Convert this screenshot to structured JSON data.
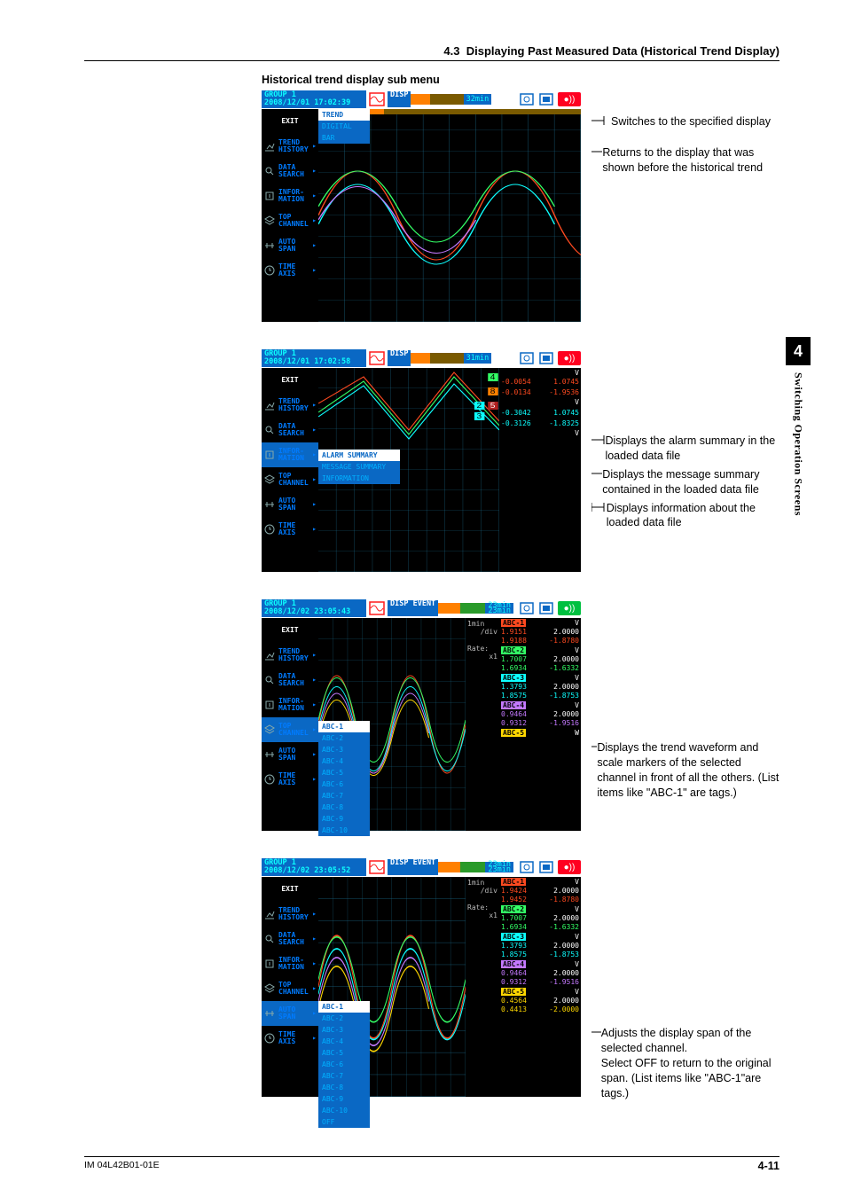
{
  "sectionNumber": "4.3",
  "sectionTitle": "Displaying Past Measured Data (Historical Trend Display)",
  "sideTabIndex": "4",
  "sideTabText": "Switching Operation Screens",
  "figureCaption": "Historical trend display sub menu",
  "footer": {
    "docNum": "IM 04L42B01-01E",
    "pageNum": "4-11"
  },
  "fig1": {
    "group": "GROUP 1",
    "timestamp": "2008/12/01 17:02:39",
    "dispLabel": "DISP",
    "timeSpan": "32min",
    "menu": [
      {
        "key": "exit",
        "label": "EXIT",
        "icon": "",
        "class": "exit"
      },
      {
        "key": "trend-history",
        "label": "TREND HISTORY",
        "icon": "chart"
      },
      {
        "key": "data-search",
        "label": "DATA SEARCH",
        "icon": "search"
      },
      {
        "key": "infor-mation",
        "label": "INFOR- MATION",
        "icon": "info"
      },
      {
        "key": "top-channel",
        "label": "TOP CHANNEL",
        "icon": "layers"
      },
      {
        "key": "auto-span",
        "label": "AUTO SPAN",
        "icon": "span"
      },
      {
        "key": "time-axis",
        "label": "TIME AXIS",
        "icon": "clock"
      }
    ],
    "submenu1": [
      "TREND",
      "DIGITAL",
      "BAR"
    ],
    "anno1": "Switches to the specified display",
    "anno2": "Returns to the display that was shown before the historical trend"
  },
  "fig2": {
    "group": "GROUP 1",
    "timestamp": "2008/12/01 17:02:58",
    "dispLabel": "DISP",
    "timeSpan": "31min",
    "menu": [
      {
        "key": "exit",
        "label": "EXIT",
        "icon": "",
        "class": "exit"
      },
      {
        "key": "trend-history",
        "label": "TREND HISTORY",
        "icon": "chart"
      },
      {
        "key": "data-search",
        "label": "DATA SEARCH",
        "icon": "search"
      },
      {
        "key": "infor-mation",
        "label": "INFOR- MATION",
        "icon": "info",
        "hot": true
      },
      {
        "key": "top-channel",
        "label": "TOP CHANNEL",
        "icon": "layers"
      },
      {
        "key": "auto-span",
        "label": "AUTO SPAN",
        "icon": "span"
      },
      {
        "key": "time-axis",
        "label": "TIME AXIS",
        "icon": "clock"
      }
    ],
    "submenu1": [
      "ALARM SUMMARY",
      "MESSAGE SUMMARY",
      "INFORMATION"
    ],
    "rightValues": [
      {
        "name": "",
        "unit": "V",
        "v1": "-0.0054",
        "v2": "1.0745",
        "c": "#ff4a20"
      },
      {
        "name": "",
        "unit": "",
        "v1": "-0.0134",
        "v2": "-1.9536",
        "c": "#ff4a20"
      },
      {
        "name": "",
        "unit": "V",
        "v1": "",
        "v2": "",
        "c": "#33ff66"
      },
      {
        "name": "",
        "unit": "",
        "v1": "-0.3042",
        "v2": "1.0745",
        "c": "#0dffff"
      },
      {
        "name": "",
        "unit": "",
        "v1": "-0.3126",
        "v2": "-1.8325",
        "c": "#0dffff"
      },
      {
        "name": "",
        "unit": "V",
        "v1": "",
        "v2": "",
        "c": "#0dffff"
      }
    ],
    "markers": [
      "4",
      "8",
      "2",
      "5",
      "3"
    ],
    "anno1": "Displays the alarm summary in the loaded data file",
    "anno2": "Displays the message summary contained in the loaded data file",
    "anno3": "Displays information about the loaded data file"
  },
  "fig3": {
    "group": "GROUP 1",
    "timestamp": "2008/12/02 23:05:43",
    "dispLabel": "DISP EVENT",
    "timeSpan1": "23min",
    "timeSpan2": "23min",
    "leftInfo": {
      "line1": "1min",
      "line2": "/div",
      "line3": "Rate:",
      "line4": "x1"
    },
    "menu": [
      {
        "key": "exit",
        "label": "EXIT",
        "icon": "",
        "class": "exit"
      },
      {
        "key": "trend-history",
        "label": "TREND HISTORY",
        "icon": "chart"
      },
      {
        "key": "data-search",
        "label": "DATA SEARCH",
        "icon": "search"
      },
      {
        "key": "infor-mation",
        "label": "INFOR- MATION",
        "icon": "info"
      },
      {
        "key": "top-channel",
        "label": "TOP CHANNEL",
        "icon": "layers",
        "hot": true
      },
      {
        "key": "auto-span",
        "label": "AUTO SPAN",
        "icon": "span"
      },
      {
        "key": "time-axis",
        "label": "TIME AXIS",
        "icon": "clock"
      }
    ],
    "submenu1": [
      "ABC-1",
      "ABC-2",
      "ABC-3",
      "ABC-4",
      "ABC-5",
      "ABC-6",
      "ABC-7",
      "ABC-8",
      "ABC-9",
      "ABC-10"
    ],
    "channels": [
      {
        "name": "ABC-1",
        "unit": "V",
        "v1": "1.9151",
        "v2": "2.0000",
        "v3": "1.9188",
        "v4": "-1.8780",
        "color": "#ff4a20"
      },
      {
        "name": "ABC-2",
        "unit": "V",
        "v1": "1.7007",
        "v2": "2.0000",
        "v3": "1.6934",
        "v4": "-1.6332",
        "color": "#33ff66"
      },
      {
        "name": "ABC-3",
        "unit": "V",
        "v1": "1.3793",
        "v2": "2.0000",
        "v3": "1.8575",
        "v4": "-1.8753",
        "color": "#0dffff"
      },
      {
        "name": "ABC-4",
        "unit": "V",
        "v1": "0.9464",
        "v2": "2.0000",
        "v3": "0.9312",
        "v4": "-1.9516",
        "color": "#c479ff"
      },
      {
        "name": "ABC-5",
        "unit": "W",
        "v1": "",
        "v2": "",
        "v3": "",
        "v4": "",
        "color": "#ffd800"
      }
    ],
    "anno1": "Displays the trend waveform and scale markers of the selected channel in front of all the others. (List items like \"ABC-1\" are tags.)"
  },
  "fig4": {
    "group": "GROUP 1",
    "timestamp": "2008/12/02 23:05:52",
    "dispLabel": "DISP EVENT",
    "timeSpan1": "23min",
    "timeSpan2": "23min",
    "leftInfo": {
      "line1": "1min",
      "line2": "/div",
      "line3": "Rate:",
      "line4": "x1"
    },
    "menu": [
      {
        "key": "exit",
        "label": "EXIT",
        "icon": "",
        "class": "exit"
      },
      {
        "key": "trend-history",
        "label": "TREND HISTORY",
        "icon": "chart"
      },
      {
        "key": "data-search",
        "label": "DATA SEARCH",
        "icon": "search"
      },
      {
        "key": "infor-mation",
        "label": "INFOR- MATION",
        "icon": "info"
      },
      {
        "key": "top-channel",
        "label": "TOP CHANNEL",
        "icon": "layers"
      },
      {
        "key": "auto-span",
        "label": "AUTO SPAN",
        "icon": "span",
        "hot": true
      },
      {
        "key": "time-axis",
        "label": "TIME AXIS",
        "icon": "clock"
      }
    ],
    "submenu1": [
      "ABC-1",
      "ABC-2",
      "ABC-3",
      "ABC-4",
      "ABC-5",
      "ABC-6",
      "ABC-7",
      "ABC-8",
      "ABC-9",
      "ABC-10",
      "OFF"
    ],
    "channels": [
      {
        "name": "ABC-1",
        "unit": "V",
        "v1": "1.9424",
        "v2": "2.0000",
        "v3": "1.9452",
        "v4": "-1.8780",
        "color": "#ff4a20"
      },
      {
        "name": "ABC-2",
        "unit": "V",
        "v1": "1.7007",
        "v2": "2.0000",
        "v3": "1.6934",
        "v4": "-1.6332",
        "color": "#33ff66"
      },
      {
        "name": "ABC-3",
        "unit": "V",
        "v1": "1.3793",
        "v2": "2.0000",
        "v3": "1.8575",
        "v4": "-1.8753",
        "color": "#0dffff"
      },
      {
        "name": "ABC-4",
        "unit": "V",
        "v1": "0.9464",
        "v2": "2.0000",
        "v3": "0.9312",
        "v4": "-1.9516",
        "color": "#c479ff"
      },
      {
        "name": "ABC-5",
        "unit": "V",
        "v1": "0.4564",
        "v2": "2.0000",
        "v3": "0.4413",
        "v4": "-2.0000",
        "color": "#ffd800"
      }
    ],
    "anno1": "Adjusts the display span of the selected channel.",
    "anno2": "Select OFF to return to the original span. (List items like \"ABC-1\"are tags.)"
  }
}
